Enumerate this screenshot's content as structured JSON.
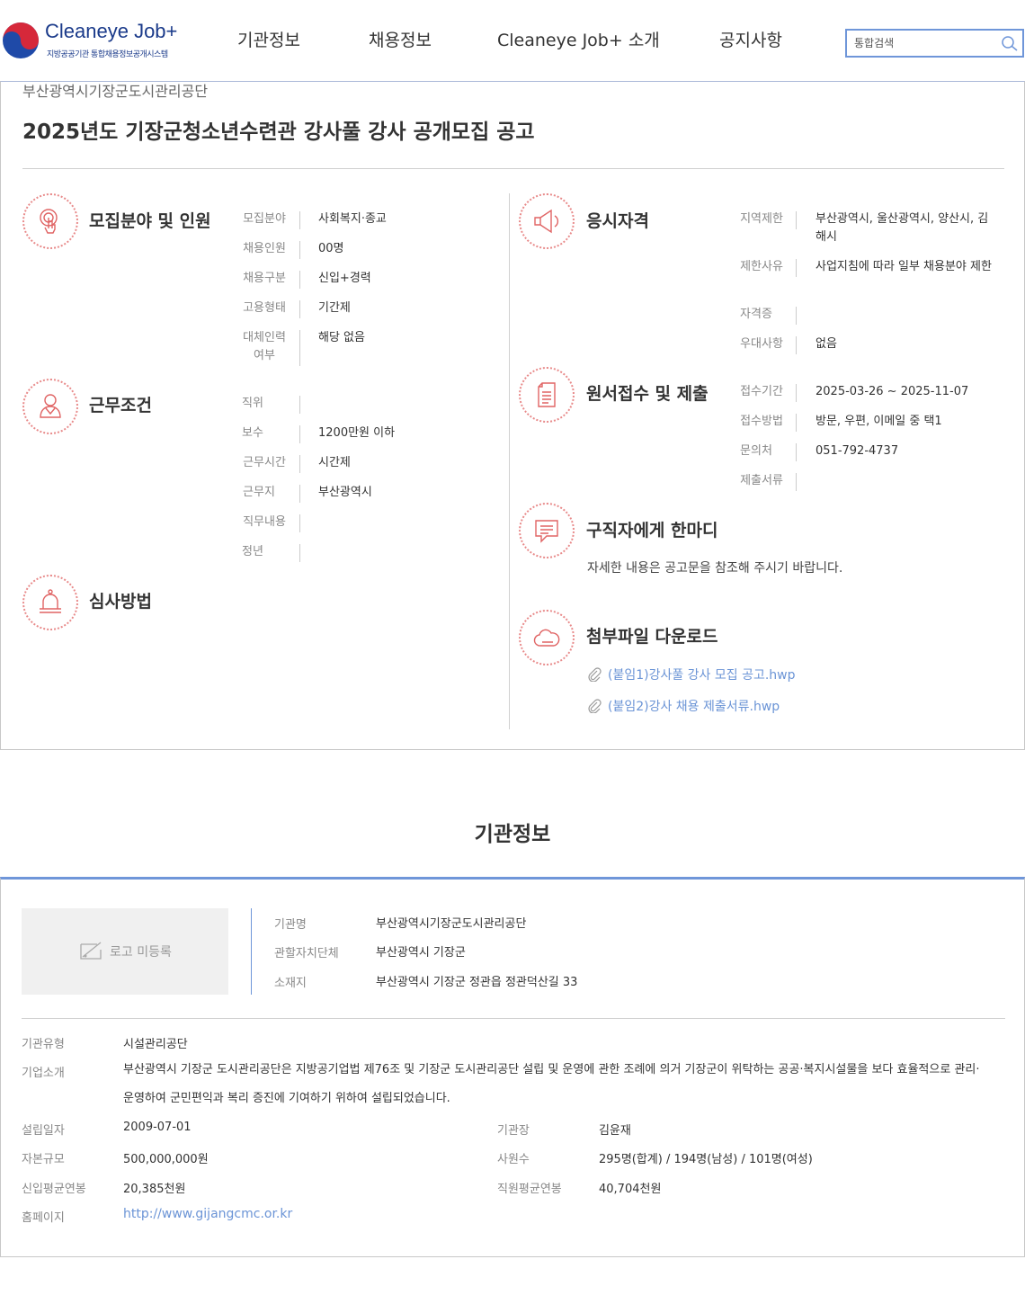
{
  "header": {
    "logo_title": "Cleaneye Job+",
    "logo_subtitle": "지방공공기관 통합채용정보공개시스템",
    "nav": [
      "기관정보",
      "채용정보",
      "Cleaneye Job+ 소개",
      "공지사항"
    ],
    "search_placeholder": "통합검색"
  },
  "job": {
    "org_name": "부산광역시기장군도시관리공단",
    "title": "2025년도 기장군청소년수련관 강사풀 강사 공개모집 공고",
    "recruit": {
      "heading": "모집분야 및 인원",
      "rows": [
        {
          "label": "모집분야",
          "value": "사회복지·종교"
        },
        {
          "label": "채용인원",
          "value": "00명"
        },
        {
          "label": "채용구분",
          "value": "신입+경력"
        },
        {
          "label": "고용형태",
          "value": "기간제"
        },
        {
          "label": "대체인력 여부",
          "value": "해당 없음"
        }
      ]
    },
    "work": {
      "heading": "근무조건",
      "rows": [
        {
          "label": "직위",
          "value": ""
        },
        {
          "label": "보수",
          "value": "1200만원 이하"
        },
        {
          "label": "근무시간",
          "value": "시간제"
        },
        {
          "label": "근무지",
          "value": "부산광역시"
        },
        {
          "label": "직무내용",
          "value": ""
        },
        {
          "label": "정년",
          "value": ""
        }
      ]
    },
    "review": {
      "heading": "심사방법"
    },
    "qualification": {
      "heading": "응시자격",
      "rows": [
        {
          "label": "지역제한",
          "value": "부산광역시, 울산광역시, 양산시, 김해시"
        },
        {
          "label": "제한사유",
          "value": "사업지침에 따라 일부 채용분야 제한"
        },
        {
          "label": "자격증",
          "value": ""
        },
        {
          "label": "우대사항",
          "value": "없음"
        }
      ]
    },
    "application": {
      "heading": "원서접수 및 제출",
      "rows": [
        {
          "label": "접수기간",
          "value": "2025-03-26 ~ 2025-11-07"
        },
        {
          "label": "접수방법",
          "value": "방문, 우편, 이메일 중 택1"
        },
        {
          "label": "문의처",
          "value": "051-792-4737"
        },
        {
          "label": "제출서류",
          "value": ""
        }
      ]
    },
    "message": {
      "heading": "구직자에게 한마디",
      "text": "자세한 내용은 공고문을 참조해 주시기 바랍니다."
    },
    "attachments": {
      "heading": "첨부파일 다운로드",
      "files": [
        "(붙임1)강사풀 강사 모집 공고.hwp",
        "(붙임2)강사 채용 제출서류.hwp"
      ]
    }
  },
  "org": {
    "heading": "기관정보",
    "logo_placeholder": "로고 미등록",
    "top_rows": [
      {
        "label": "기관명",
        "value": "부산광역시기장군도시관리공단"
      },
      {
        "label": "관할자치단체",
        "value": "부산광역시 기장군"
      },
      {
        "label": "소재지",
        "value": "부산광역시 기장군 정관읍 정관덕산길 33"
      }
    ],
    "type_label": "기관유형",
    "type_value": "시설관리공단",
    "intro_label": "기업소개",
    "intro_value": "부산광역시 기장군 도시관리공단은 지방공기업법 제76조 및 기장군 도시관리공단 설립 및 운영에 관한 조례에 의거 기장군이 위탁하는 공공·복지시설물을 보다 효율적으로 관리·운영하여 군민편익과 복리 증진에 기여하기 위하여 설립되었습니다.",
    "founded_label": "설립일자",
    "founded_value": "2009-07-01",
    "ceo_label": "기관장",
    "ceo_value": "김윤재",
    "capital_label": "자본규모",
    "capital_value": "500,000,000원",
    "staff_label": "사원수",
    "staff_value": "295명(합계) / 194명(남성) / 101명(여성)",
    "new_salary_label": "신입평균연봉",
    "new_salary_value": "20,385천원",
    "avg_salary_label": "직원평균연봉",
    "avg_salary_value": "40,704천원",
    "homepage_label": "홈페이지",
    "homepage_value": "http://www.gijangcmc.or.kr"
  }
}
